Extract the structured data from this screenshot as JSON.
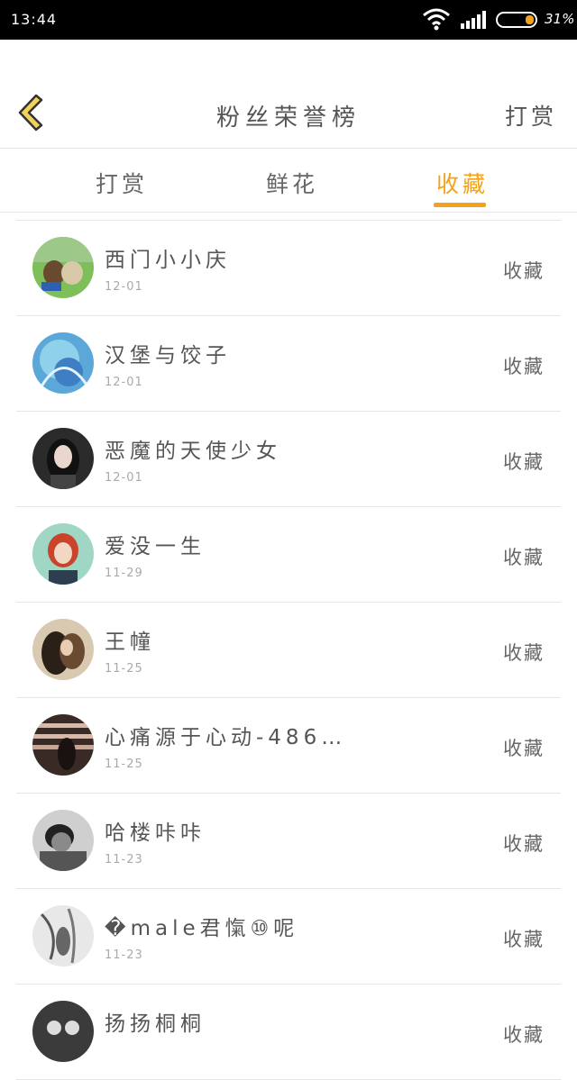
{
  "status_bar": {
    "time": "13:44",
    "battery": "31%"
  },
  "header": {
    "title": "粉丝荣誉榜",
    "action": "打赏",
    "back_icon": "chevron-left-icon"
  },
  "tabs": [
    {
      "label": "打赏",
      "active": false
    },
    {
      "label": "鲜花",
      "active": false
    },
    {
      "label": "收藏",
      "active": true
    }
  ],
  "colors": {
    "accent": "#f2a31b",
    "back_icon_fill": "#f3d25a",
    "back_icon_stroke": "#333333",
    "status_bar_bg": "#000000"
  },
  "list": [
    {
      "name": "西门小小庆",
      "date": "12-01",
      "action": "收藏"
    },
    {
      "name": "汉堡与饺子",
      "date": "12-01",
      "action": "收藏"
    },
    {
      "name": "恶魔的天使少女",
      "date": "12-01",
      "action": "收藏"
    },
    {
      "name": "爱没一生",
      "date": "11-29",
      "action": "收藏"
    },
    {
      "name": "王幢",
      "date": "11-25",
      "action": "收藏"
    },
    {
      "name": "心痛源于心动-486…",
      "date": "11-25",
      "action": "收藏"
    },
    {
      "name": "哈楼咔咔",
      "date": "11-23",
      "action": "收藏"
    },
    {
      "name": "�male君愾⑩呢",
      "date": "11-23",
      "action": "收藏"
    },
    {
      "name": "扬扬桐桐",
      "date": "",
      "action": "收藏"
    }
  ]
}
